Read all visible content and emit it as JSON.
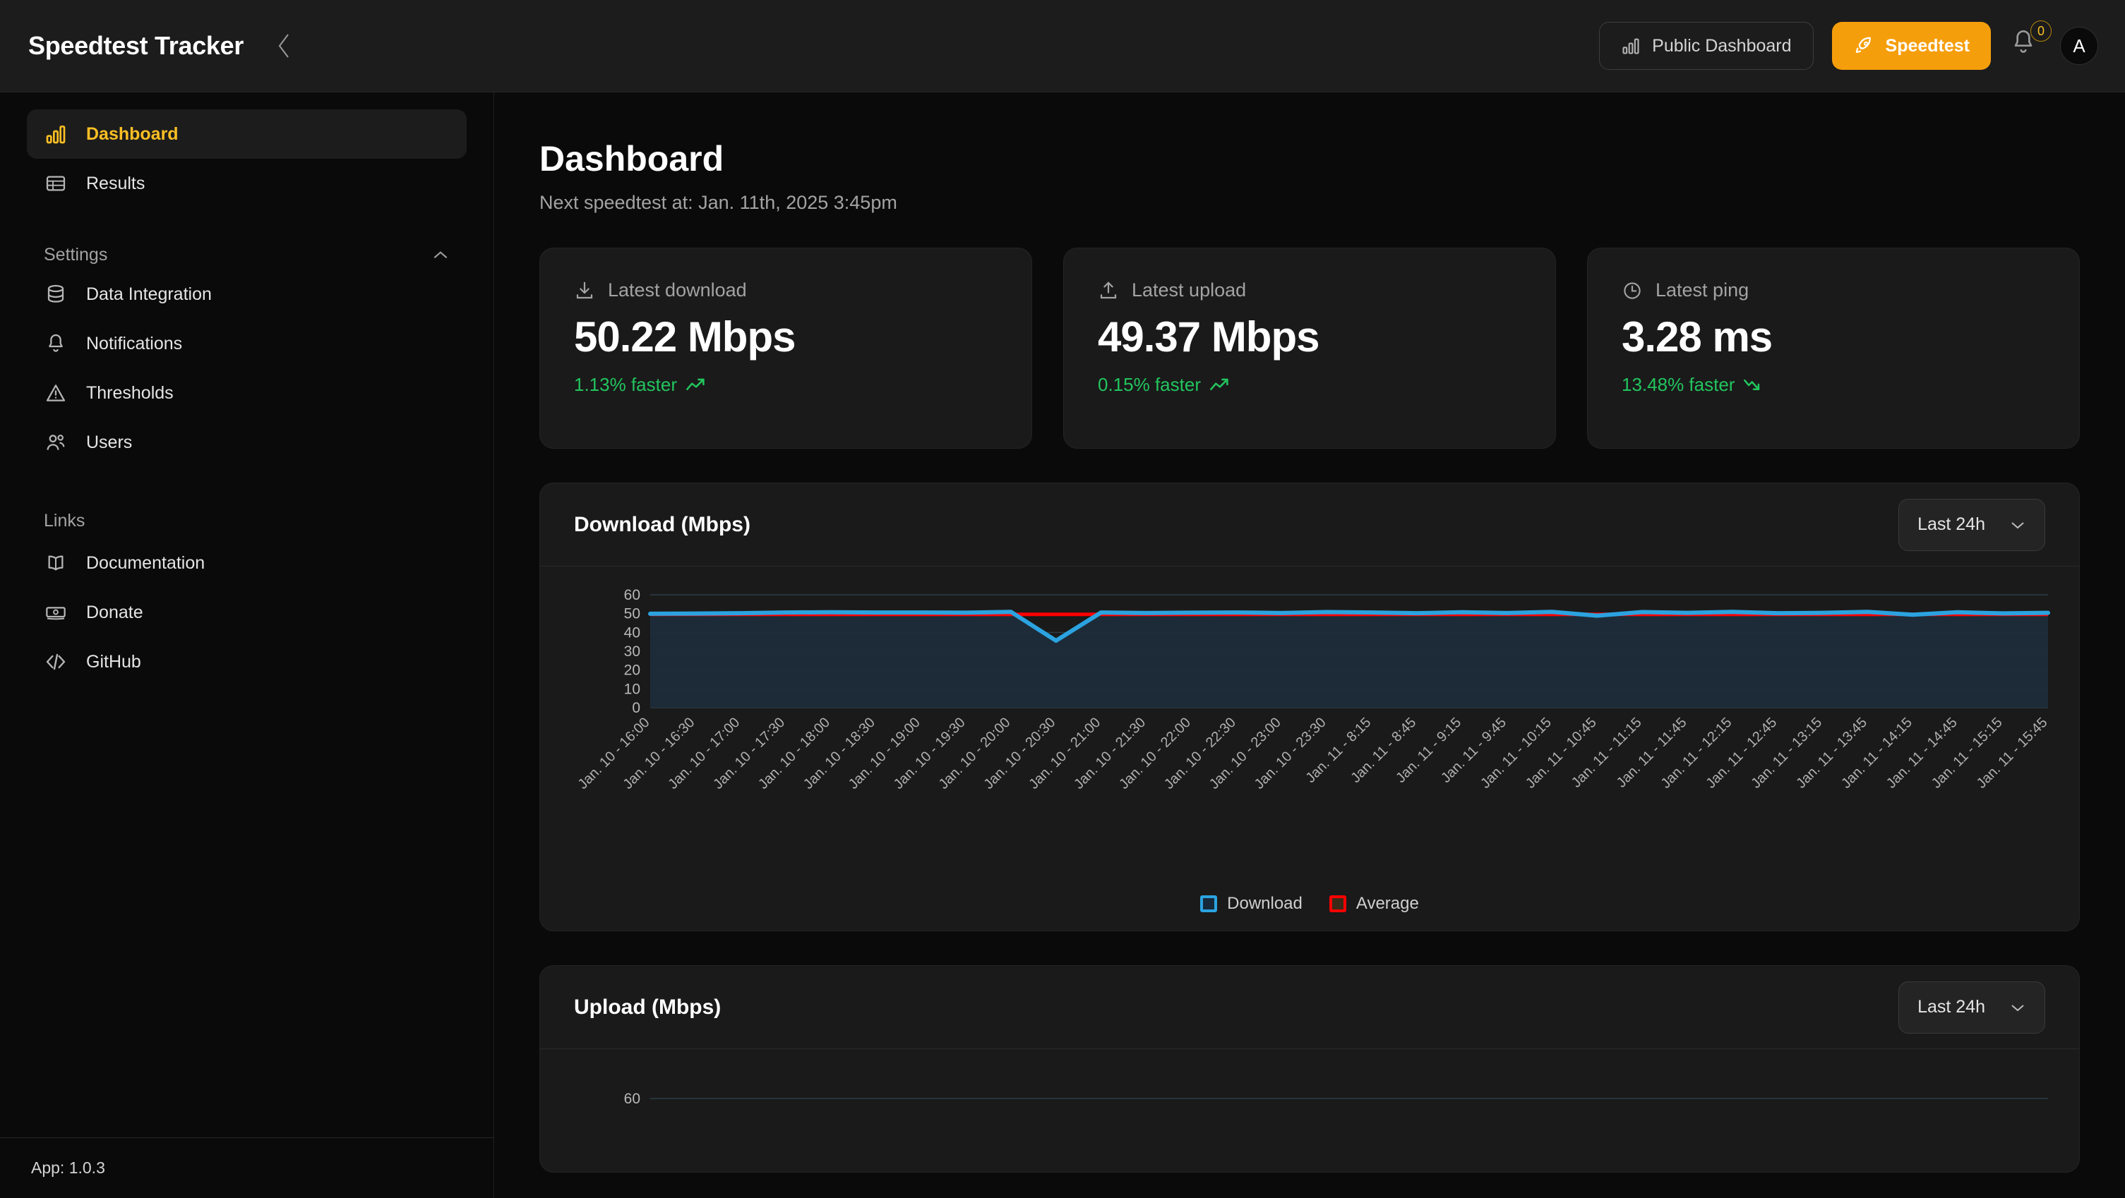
{
  "topbar": {
    "brand": "Speedtest Tracker",
    "collapse_icon": "chevron-left-icon",
    "public_dashboard_label": "Public Dashboard",
    "public_dashboard_icon": "bar-chart-icon",
    "speedtest_label": "Speedtest",
    "speedtest_icon": "rocket-icon",
    "notifications_icon": "bell-icon",
    "notifications_count": "0",
    "avatar_initial": "A",
    "accent_color": "#f59e0b"
  },
  "sidebar": {
    "items": [
      {
        "label": "Dashboard",
        "icon": "bar-chart-icon",
        "active": true
      },
      {
        "label": "Results",
        "icon": "table-icon",
        "active": false
      }
    ],
    "settings_section": {
      "label": "Settings",
      "caret_icon": "chevron-up-icon",
      "items": [
        {
          "label": "Data Integration",
          "icon": "database-icon"
        },
        {
          "label": "Notifications",
          "icon": "bell-icon"
        },
        {
          "label": "Thresholds",
          "icon": "alert-triangle-icon"
        },
        {
          "label": "Users",
          "icon": "users-icon"
        }
      ]
    },
    "links_section": {
      "label": "Links",
      "items": [
        {
          "label": "Documentation",
          "icon": "book-icon"
        },
        {
          "label": "Donate",
          "icon": "banknote-icon"
        },
        {
          "label": "GitHub",
          "icon": "code-icon"
        }
      ]
    },
    "footer": "App: 1.0.3"
  },
  "page": {
    "title": "Dashboard",
    "subtitle": "Next speedtest at: Jan. 11th, 2025 3:45pm"
  },
  "stats": [
    {
      "label": "Latest download",
      "icon": "download-icon",
      "value": "50.22 Mbps",
      "delta": "1.13% faster",
      "delta_icon": "trending-up-icon",
      "delta_color": "#22c55e"
    },
    {
      "label": "Latest upload",
      "icon": "upload-icon",
      "value": "49.37 Mbps",
      "delta": "0.15% faster",
      "delta_icon": "trending-up-icon",
      "delta_color": "#22c55e"
    },
    {
      "label": "Latest ping",
      "icon": "clock-icon",
      "value": "3.28 ms",
      "delta": "13.48% faster",
      "delta_icon": "trending-down-icon",
      "delta_color": "#22c55e"
    }
  ],
  "download_card": {
    "title": "Download (Mbps)",
    "range_value": "Last 24h",
    "range_caret_icon": "chevron-down-icon"
  },
  "upload_card": {
    "title": "Upload (Mbps)",
    "range_value": "Last 24h",
    "range_caret_icon": "chevron-down-icon"
  },
  "chart_data": [
    {
      "type": "line",
      "title": "Download (Mbps)",
      "xlabel": "",
      "ylabel": "",
      "ylim": [
        0,
        60
      ],
      "yticks": [
        0,
        10,
        20,
        30,
        40,
        50,
        60
      ],
      "grid": true,
      "legend_position": "bottom",
      "legend": [
        "Download",
        "Average"
      ],
      "colors": {
        "Download": "#2ba3e0",
        "Average": "#ff0000"
      },
      "categories": [
        "Jan. 10 - 16:00",
        "Jan. 10 - 16:30",
        "Jan. 10 - 17:00",
        "Jan. 10 - 17:30",
        "Jan. 10 - 18:00",
        "Jan. 10 - 18:30",
        "Jan. 10 - 19:00",
        "Jan. 10 - 19:30",
        "Jan. 10 - 20:00",
        "Jan. 10 - 20:30",
        "Jan. 10 - 21:00",
        "Jan. 10 - 21:30",
        "Jan. 10 - 22:00",
        "Jan. 10 - 22:30",
        "Jan. 10 - 23:00",
        "Jan. 10 - 23:30",
        "Jan. 11 - 8:15",
        "Jan. 11 - 8:45",
        "Jan. 11 - 9:15",
        "Jan. 11 - 9:45",
        "Jan. 11 - 10:15",
        "Jan. 11 - 10:45",
        "Jan. 11 - 11:15",
        "Jan. 11 - 11:45",
        "Jan. 11 - 12:15",
        "Jan. 11 - 12:45",
        "Jan. 11 - 13:15",
        "Jan. 11 - 13:45",
        "Jan. 11 - 14:15",
        "Jan. 11 - 14:45",
        "Jan. 11 - 15:15",
        "Jan. 11 - 15:45"
      ],
      "series": [
        {
          "name": "Download",
          "values": [
            49.9,
            50.0,
            50.2,
            50.6,
            50.7,
            50.6,
            50.6,
            50.5,
            50.9,
            35.6,
            50.6,
            50.3,
            50.5,
            50.6,
            50.3,
            50.8,
            50.6,
            50.2,
            50.7,
            50.3,
            50.9,
            48.9,
            50.8,
            50.4,
            50.9,
            50.2,
            50.4,
            50.9,
            49.4,
            50.7,
            50.1,
            50.4
          ]
        },
        {
          "name": "Average",
          "values": [
            49.6,
            49.6,
            49.6,
            49.6,
            49.6,
            49.6,
            49.6,
            49.6,
            49.6,
            49.6,
            49.6,
            49.6,
            49.6,
            49.6,
            49.6,
            49.6,
            49.6,
            49.6,
            49.6,
            49.6,
            49.6,
            49.6,
            49.6,
            49.6,
            49.6,
            49.6,
            49.6,
            49.6,
            49.6,
            49.6,
            49.6,
            49.6
          ]
        }
      ]
    },
    {
      "type": "line",
      "title": "Upload (Mbps)",
      "ylim": [
        0,
        60
      ],
      "yticks": [
        60
      ],
      "grid": true,
      "note": "partially visible at bottom of viewport"
    }
  ]
}
